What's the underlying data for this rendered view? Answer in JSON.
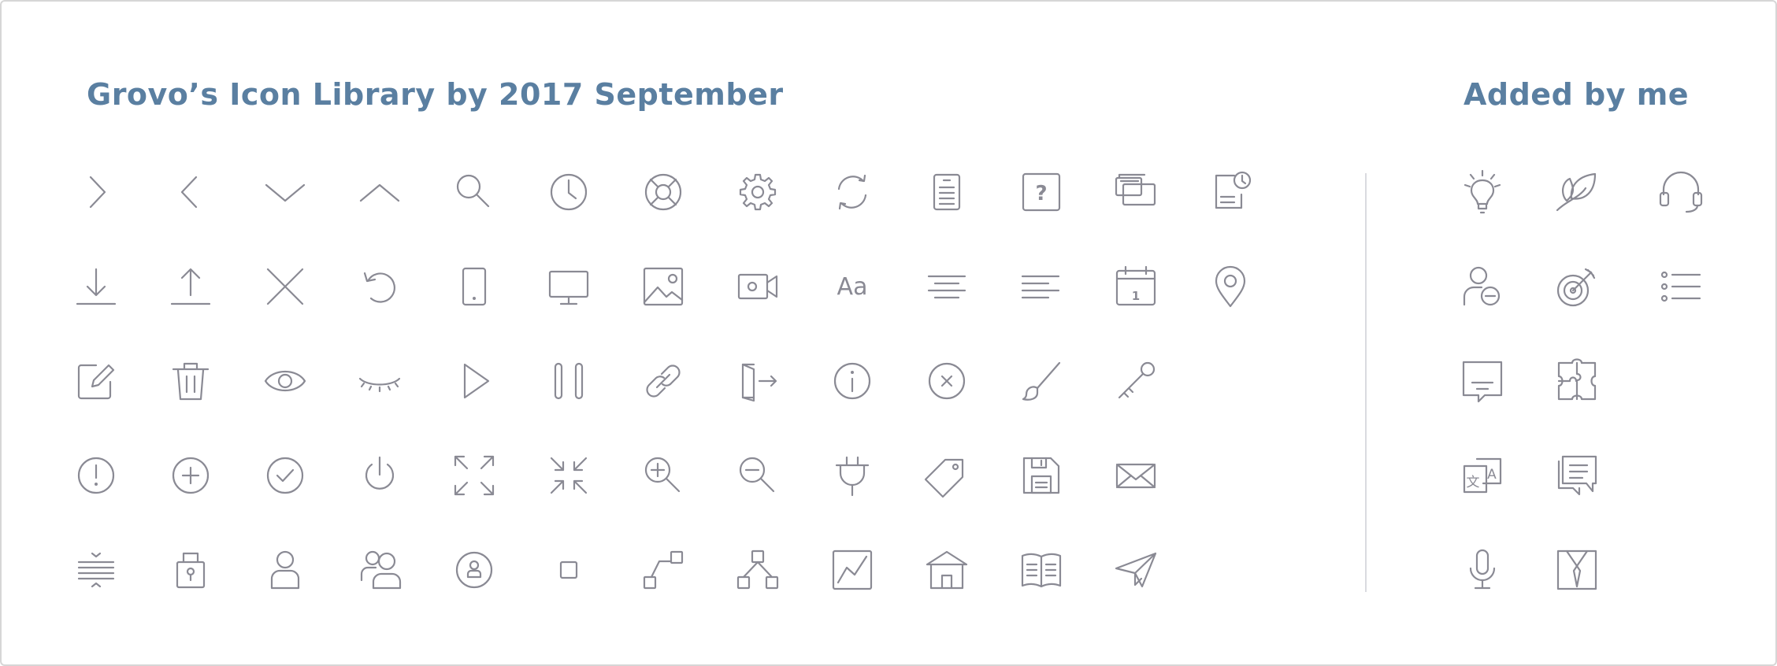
{
  "titles": {
    "main": "Grovo’s Icon Library by 2017 September",
    "added": "Added by me"
  },
  "library_icons": [
    [
      "chevron-right-icon",
      "chevron-left-icon",
      "chevron-down-icon",
      "chevron-up-icon",
      "search-icon",
      "clock-icon",
      "lifebuoy-icon",
      "gear-icon",
      "refresh-icon",
      "document-icon",
      "help-document-icon",
      "stacked-windows-icon",
      "document-clock-icon"
    ],
    [
      "download-icon",
      "upload-icon",
      "close-icon",
      "undo-icon",
      "tablet-icon",
      "monitor-icon",
      "image-icon",
      "video-camera-icon",
      "font-size-icon",
      "align-center-icon",
      "align-left-icon",
      "calendar-icon",
      "map-pin-icon"
    ],
    [
      "edit-icon",
      "trash-icon",
      "eye-icon",
      "eye-closed-icon",
      "play-icon",
      "pause-icon",
      "link-icon",
      "exit-door-icon",
      "info-icon",
      "close-circle-icon",
      "brush-icon",
      "key-icon"
    ],
    [
      "alert-circle-icon",
      "add-circle-icon",
      "check-circle-icon",
      "power-icon",
      "expand-icon",
      "collapse-icon",
      "zoom-in-icon",
      "zoom-out-icon",
      "plug-icon",
      "tag-icon",
      "save-icon",
      "mail-icon"
    ],
    [
      "line-spacing-icon",
      "lock-icon",
      "user-icon",
      "users-icon",
      "user-circle-icon",
      "square-icon",
      "connection-icon",
      "hierarchy-icon",
      "chart-line-icon",
      "home-icon",
      "book-open-icon",
      "send-icon"
    ]
  ],
  "added_icons": [
    [
      "lightbulb-icon",
      "leaf-icon",
      "headset-icon"
    ],
    [
      "remove-user-icon",
      "target-icon",
      "list-icon"
    ],
    [
      "subtitle-comment-icon",
      "puzzle-icon"
    ],
    [
      "translate-icon",
      "chat-bubbles-icon"
    ],
    [
      "microphone-icon",
      "shirt-tie-icon"
    ]
  ],
  "glyphs": {
    "font_size": "Aa",
    "help": "?",
    "calendar_day": "1",
    "translate_a": "A",
    "translate_char": "文"
  },
  "icon_color": "#8a8a94",
  "title_color": "#5a7fa1",
  "divider_color": "#dadbe0"
}
